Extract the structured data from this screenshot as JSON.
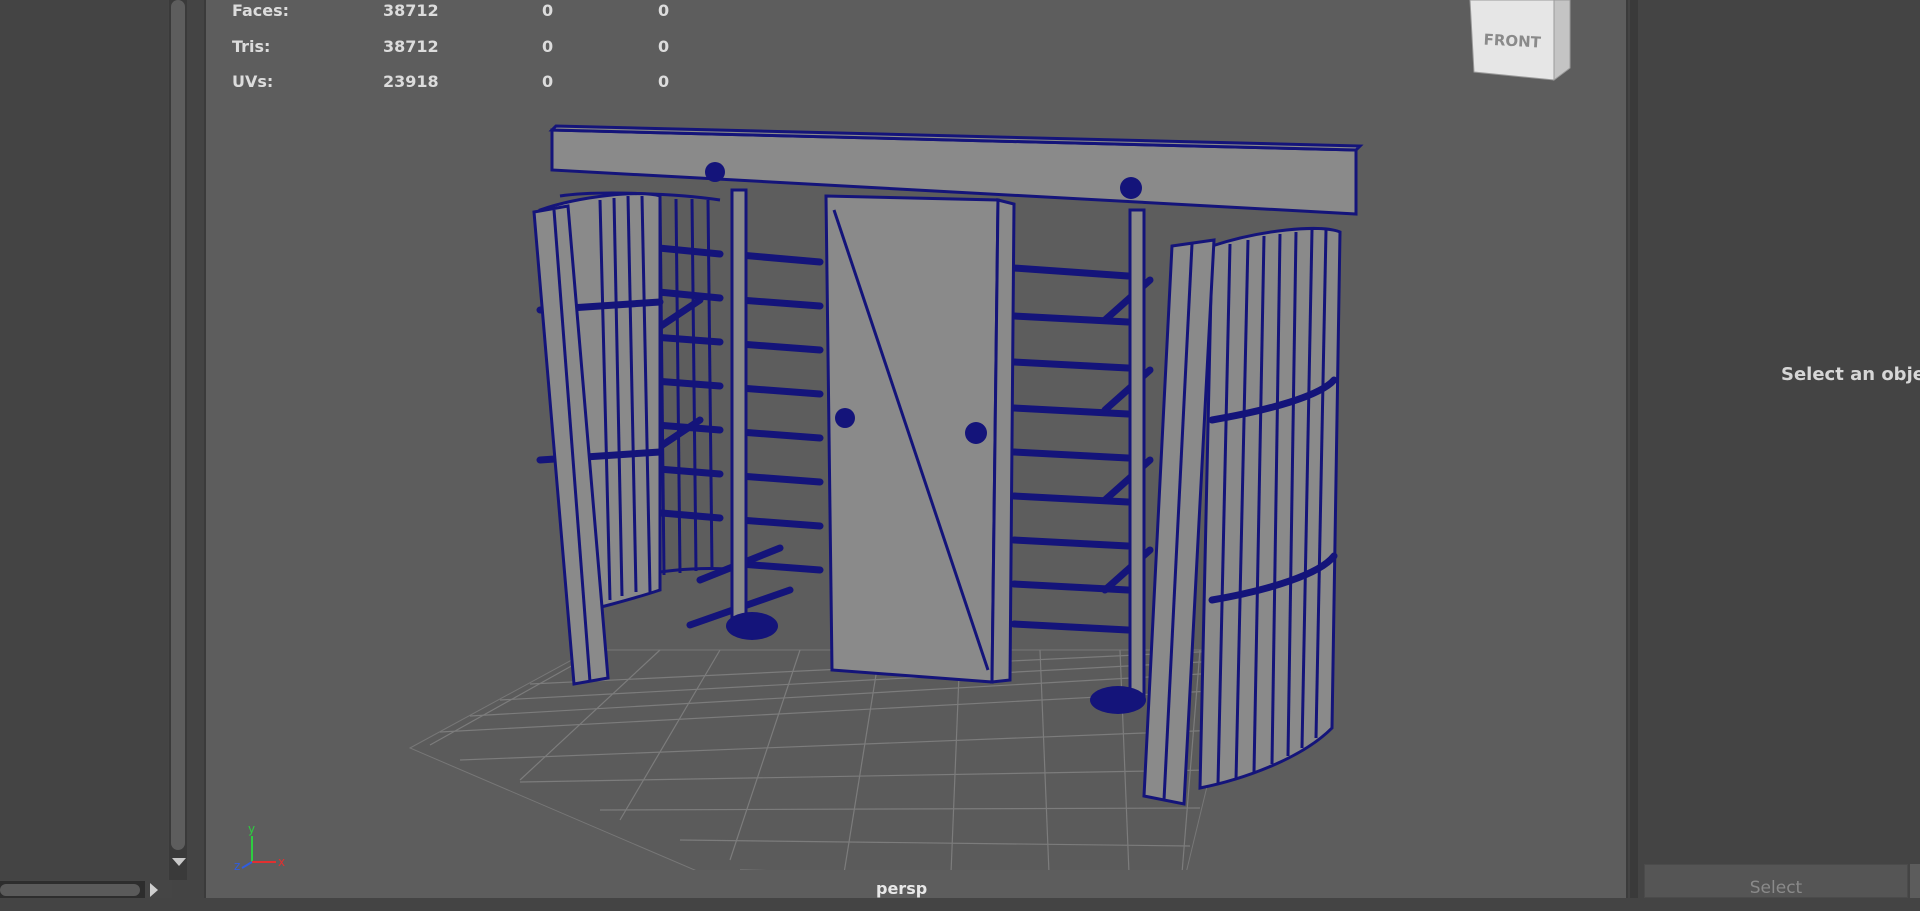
{
  "hud_stats": [
    {
      "label": "Faces:",
      "total": "38712",
      "selected": "0",
      "selected2": "0"
    },
    {
      "label": "Tris:",
      "total": "38712",
      "selected": "0",
      "selected2": "0"
    },
    {
      "label": "UVs:",
      "total": "23918",
      "selected": "0",
      "selected2": "0"
    }
  ],
  "viewcube": {
    "face_label": "FRONT"
  },
  "viewport": {
    "camera_name": "persp"
  },
  "axis": {
    "y": "y",
    "z": "z",
    "x": "x"
  },
  "attribute_editor": {
    "message": "Select an objec",
    "select_button": "Select"
  },
  "colors": {
    "wireframe": "#14147a",
    "viewport_bg": "#5d5d5d",
    "panel_bg": "#444444",
    "mesh_fill": "#8a8a8a"
  }
}
